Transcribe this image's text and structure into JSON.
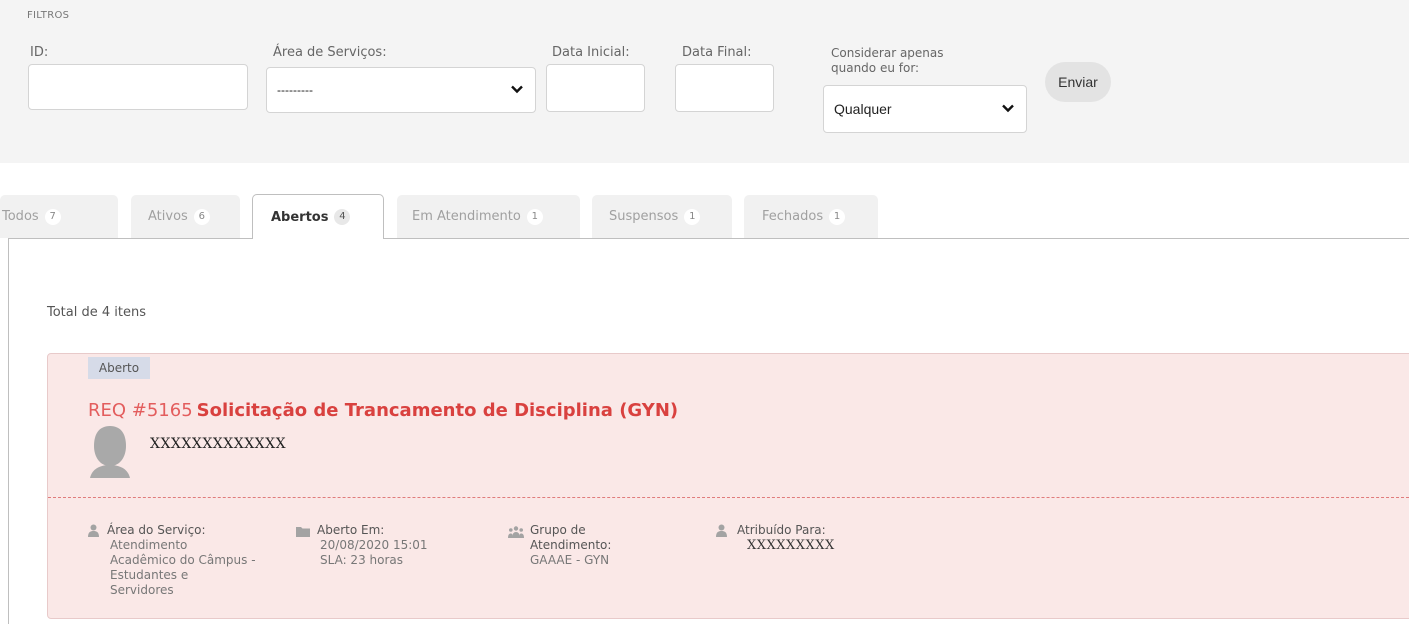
{
  "filters": {
    "title": "FILTROS",
    "id_label": "ID:",
    "id_value": "",
    "area_label": "Área de Serviços:",
    "area_value": "---------",
    "data_inicial_label": "Data Inicial:",
    "data_inicial_value": "",
    "data_final_label": "Data Final:",
    "data_final_value": "",
    "considerar_label_line1": "Considerar apenas",
    "considerar_label_line2": "quando eu for:",
    "considerar_value": "Qualquer",
    "submit_label": "Enviar"
  },
  "tabs": [
    {
      "label": "Todos",
      "count": "7"
    },
    {
      "label": "Ativos",
      "count": "6"
    },
    {
      "label": "Abertos",
      "count": "4"
    },
    {
      "label": "Em Atendimento",
      "count": "1"
    },
    {
      "label": "Suspensos",
      "count": "1"
    },
    {
      "label": "Fechados",
      "count": "1"
    }
  ],
  "active_tab": "Abertos",
  "results": {
    "total_text": "Total de 4 itens"
  },
  "item": {
    "status": "Aberto",
    "req_number": "REQ #5165",
    "title": "Solicitação de Trancamento de Disciplina (GYN)",
    "requester": "XXXXXXXXXXXXX",
    "area_label": "Área do Serviço:",
    "area_lines": [
      "Atendimento",
      "Acadêmico do Câmpus -",
      "Estudantes e",
      "Servidores"
    ],
    "aberto_label": "Aberto Em:",
    "aberto_date": "20/08/2020 15:01",
    "sla": "SLA: 23 horas",
    "grupo_label_line1": "Grupo de",
    "grupo_label_line2": "Atendimento:",
    "grupo_value": "GAAAE - GYN",
    "atribuido_label": "Atribuído Para:",
    "atribuido_value": "XXXXXXXXX"
  },
  "colors": {
    "card_bg": "#fae8e7",
    "title_red": "#d9413f",
    "divider": "#e07c7c",
    "badge_bg": "#d6dbe8"
  },
  "icons": [
    "chevron-down-icon",
    "user-icon",
    "folder-icon",
    "group-icon",
    "avatar-placeholder"
  ]
}
